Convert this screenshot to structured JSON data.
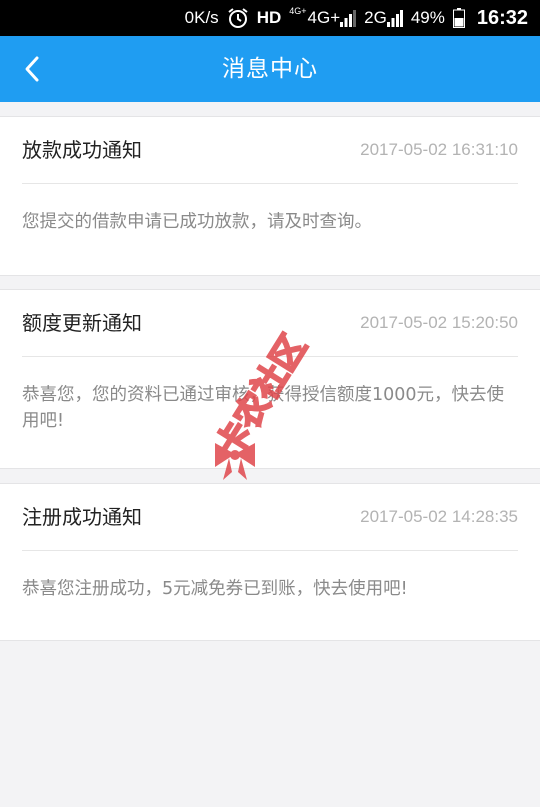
{
  "status_bar": {
    "network_speed": "0K/s",
    "hd": "HD",
    "network_1_sup": "4G+",
    "network_1": "4G+",
    "network_2": "2G",
    "battery": "49%",
    "time": "16:32"
  },
  "header": {
    "title": "消息中心",
    "background_color": "#1f9df2"
  },
  "messages": [
    {
      "title": "放款成功通知",
      "time": "2017-05-02 16:31:10",
      "body": "您提交的借款申请已成功放款，请及时查询。"
    },
    {
      "title": "额度更新通知",
      "time": "2017-05-02 15:20:50",
      "body": "恭喜您，您的资料已通过审核，获得授信额度1000元，快去使用吧!"
    },
    {
      "title": "注册成功通知",
      "time": "2017-05-02 14:28:35",
      "body": "恭喜您注册成功，5元减免券已到账，快去使用吧!"
    }
  ],
  "watermark": {
    "text": "卡农社区"
  }
}
